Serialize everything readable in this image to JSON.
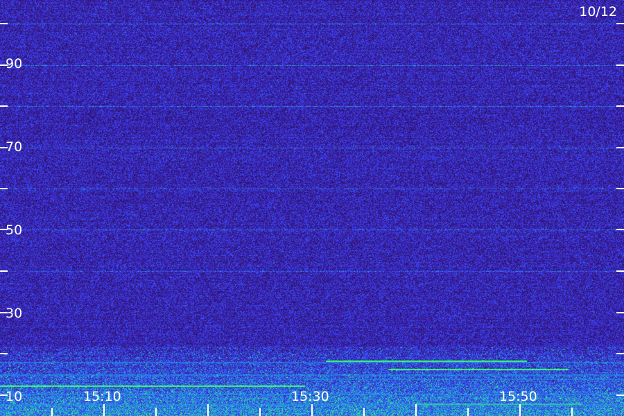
{
  "chart_data": {
    "type": "heatmap",
    "date_label": "10/12",
    "y_tick_labels": [
      "10",
      "30",
      "50",
      "70",
      "90"
    ],
    "x_tick_labels": [
      "15:10",
      "15:30",
      "15:50"
    ],
    "ylim": [
      0,
      100
    ],
    "colors": {
      "background": "#2a0f5e",
      "noise_low": "#3a1a8a",
      "noise_high": "#3c3cff",
      "signal_mid": "#1ea0e6",
      "signal_high": "#3cff6e",
      "tick": "#ffffff"
    }
  }
}
